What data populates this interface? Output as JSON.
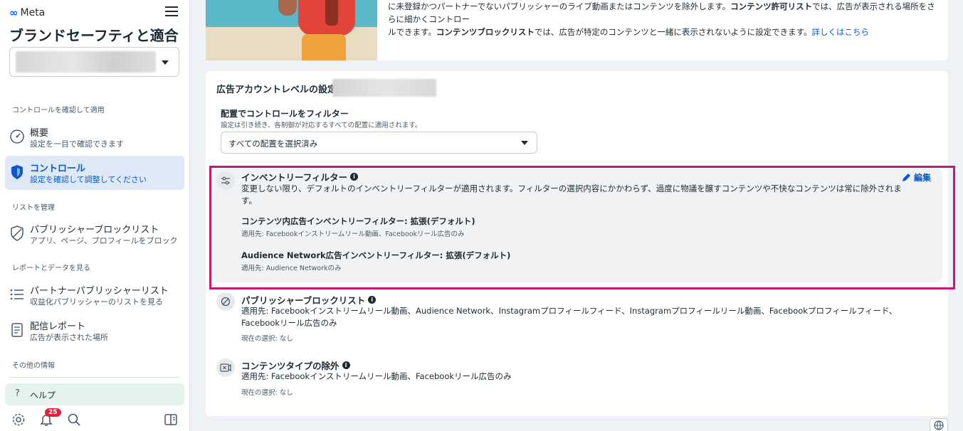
{
  "sidebar": {
    "brand": "Meta",
    "title": "ブランドセーフティと適合性",
    "sections": {
      "review": "コントロールを確認して適用",
      "lists": "リストを管理",
      "reports": "レポートとデータを見る",
      "other": "その他の情報"
    },
    "items": [
      {
        "title": "概要",
        "sub": "設定を一目で確認できます"
      },
      {
        "title": "コントロール",
        "sub": "設定を確認して調整してください"
      },
      {
        "title": "パブリッシャーブロックリスト",
        "sub": "アプリ、ページ、プロフィールをブロック"
      },
      {
        "title": "パートナーパブリッシャーリスト",
        "sub": "収益化パブリッシャーのリストを見る"
      },
      {
        "title": "配信レポート",
        "sub": "広告が表示された場所"
      }
    ],
    "help": "ヘルプ",
    "notification_count": "25"
  },
  "top_card": {
    "line1_a": "に未登録かつパートナーでないパブリッシャーのライブ動画またはコンテンツを除外します。",
    "line1_b": "コンテンツ許可リスト",
    "line1_c": "では、広告が表示される場所をさらに細かくコントロー",
    "line2_a": "ルできます。",
    "line2_b": "コンテンツブロックリスト",
    "line2_c": "では、広告が特定のコンテンツと一緒に表示されないように設定できます。",
    "link": "詳しくはこちら"
  },
  "main": {
    "account_level": "広告アカウントレベルの設定:",
    "filter_title": "配置でコントロールをフィルター",
    "filter_sub": "設定は引き続き、各制御が対応するすべての配置に適用されます。",
    "placement_value": "すべての配置を選択済み",
    "inventory": {
      "title": "インベントリーフィルター",
      "edit": "編集",
      "desc1": "変更しない限り、デフォルトのインベントリーフィルターが適用されます。フィルターの選択内容にかかわらず、過度に物議を醸すコンテンツや不快なコンテンツは常に除外されま",
      "desc2": "す。",
      "in_content_title": "コンテンツ内広告インベントリーフィルター: 拡張(デフォルト)",
      "in_content_sub": "適用先: Facebookインストリームリール動画、Facebookリール広告のみ",
      "an_title": "Audience Network広告インベントリーフィルター: 拡張(デフォルト)",
      "an_sub": "適用先: Audience Networkのみ"
    },
    "blocklist": {
      "title": "パブリッシャーブロックリスト",
      "applies1": "適用先: Facebookインストリームリール動画、Audience Network、Instagramプロフィールフィード、Instagramプロフィールリール動画、Facebookプロフィールフィード、",
      "applies2": "Facebookリール広告のみ",
      "current": "現在の選択: なし"
    },
    "content_type": {
      "title": "コンテンツタイプの除外",
      "applies": "適用先: Facebookインストリームリール動画、Facebookリール広告のみ",
      "current": "現在の選択: なし"
    }
  },
  "colors": {
    "accent": "#0a58ca",
    "highlight": "#c2187a",
    "badge": "#e41e3f"
  }
}
